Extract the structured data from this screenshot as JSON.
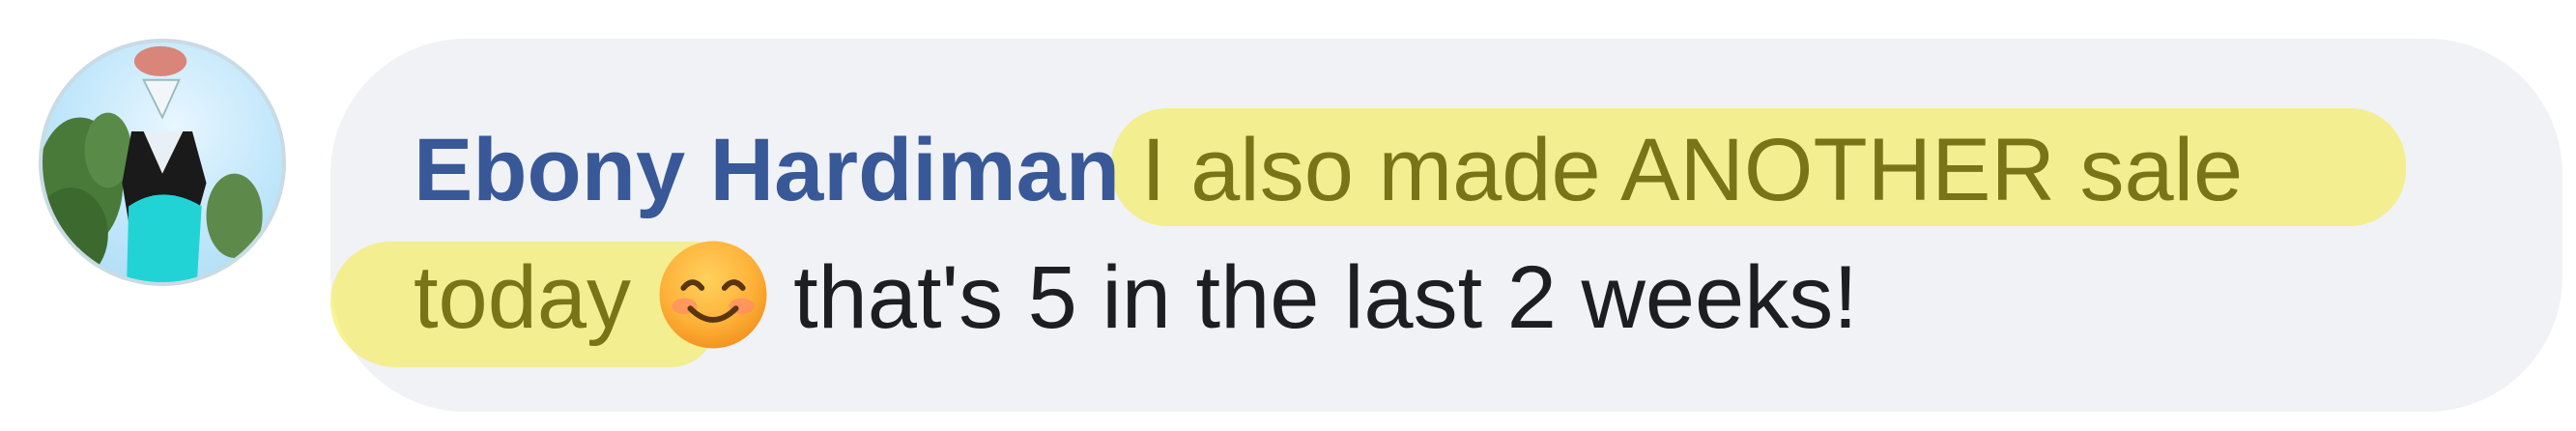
{
  "comment": {
    "author": "Ebony Hardiman",
    "text_highlighted_1": "I also made ANOTHER sale",
    "text_highlighted_2": "today",
    "emoji": "smiling-face-with-smiling-eyes",
    "text_rest": "that's 5 in the last 2 weeks!"
  },
  "colors": {
    "author": "#385898",
    "bubble": "#f0f2f5",
    "highlight": "#f5ec50",
    "body_text": "#1c1e21"
  }
}
